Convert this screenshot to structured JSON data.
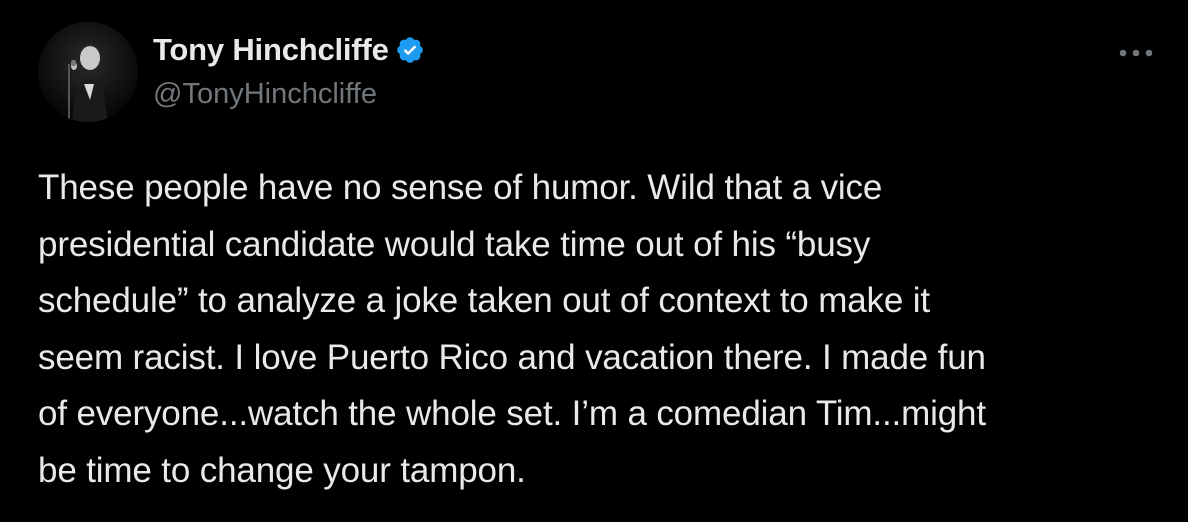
{
  "author": {
    "display_name": "Tony Hinchcliffe",
    "handle": "@TonyHinchcliffe",
    "verified": true
  },
  "post": {
    "text_lines": [
      "These people have no sense of humor. Wild that a vice",
      "presidential candidate would take time out of his “busy",
      "schedule” to analyze a joke taken out of context to make it",
      "seem racist. I love Puerto Rico and vacation there. I made fun",
      "of everyone...watch the whole set. I’m a comedian Tim...might",
      "be time to change your tampon."
    ]
  },
  "icons": {
    "verified": "verified-badge-icon",
    "more": "more-options-icon"
  },
  "colors": {
    "background": "#000000",
    "text_primary": "#e7e9ea",
    "text_secondary": "#71767b",
    "verified_blue": "#1d9bf0"
  }
}
